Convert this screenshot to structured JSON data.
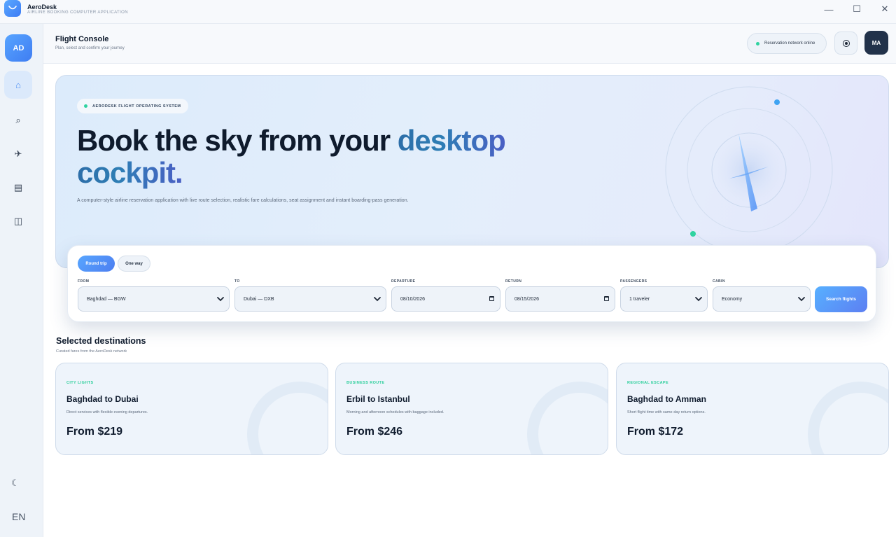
{
  "app": {
    "name": "AeroDesk",
    "subtitle": "AIRLINE BOOKING COMPUTER APPLICATION"
  },
  "window_controls": {
    "minimize": "—",
    "maximize": "☐",
    "close": "✕"
  },
  "sidebar": {
    "avatar": "AD",
    "items": [
      {
        "name": "home",
        "icon": "home-icon",
        "glyph": "⌂",
        "active": true
      },
      {
        "name": "search",
        "icon": "search-icon",
        "glyph": "⌕",
        "active": false
      },
      {
        "name": "flights",
        "icon": "airplane-icon",
        "glyph": "✈",
        "active": false
      },
      {
        "name": "bookings",
        "icon": "list-icon",
        "glyph": "▤",
        "active": false
      },
      {
        "name": "boarding",
        "icon": "columns-icon",
        "glyph": "◫",
        "active": false
      }
    ],
    "theme_glyph": "☾",
    "language": "EN"
  },
  "header": {
    "title": "Flight Console",
    "subtitle": "Plan, select and confirm your journey",
    "status": "Reservation network online",
    "user_initials": "MA"
  },
  "hero": {
    "badge": "AERODESK FLIGHT OPERATING SYSTEM",
    "title_main": "Book the sky from your ",
    "title_accent_1": "desktop",
    "title_accent_2": "cockpit.",
    "description": "A computer-style airline reservation application with live route selection, realistic fare calculations, seat assignment and instant boarding-pass generation."
  },
  "search": {
    "trip_types": [
      "Round trip",
      "One way"
    ],
    "selected_trip": "Round trip",
    "fields": {
      "from": {
        "label": "FROM",
        "value": "Baghdad — BGW"
      },
      "to": {
        "label": "TO",
        "value": "Dubai — DXB"
      },
      "departure": {
        "label": "DEPARTURE",
        "value": "08/10/2026"
      },
      "return": {
        "label": "RETURN",
        "value": "08/15/2026"
      },
      "passengers": {
        "label": "PASSENGERS",
        "value": "1 traveler"
      },
      "cabin": {
        "label": "CABIN",
        "value": "Economy"
      }
    },
    "submit": "Search flights"
  },
  "destinations": {
    "title": "Selected destinations",
    "subtitle": "Curated fares from the AeroDesk network",
    "cards": [
      {
        "tag": "CITY LIGHTS",
        "route": "Baghdad to Dubai",
        "description": "Direct services with flexible evening departures.",
        "price": "From $219"
      },
      {
        "tag": "BUSINESS ROUTE",
        "route": "Erbil to Istanbul",
        "description": "Morning and afternoon schedules with baggage included.",
        "price": "From $246"
      },
      {
        "tag": "REGIONAL ESCAPE",
        "route": "Baghdad to Amman",
        "description": "Short flight time with same-day return options.",
        "price": "From $172"
      }
    ]
  },
  "colors": {
    "accent_blue": "#4d8ef5",
    "online_green": "#2fd3a0",
    "dark_navy": "#22324a"
  }
}
